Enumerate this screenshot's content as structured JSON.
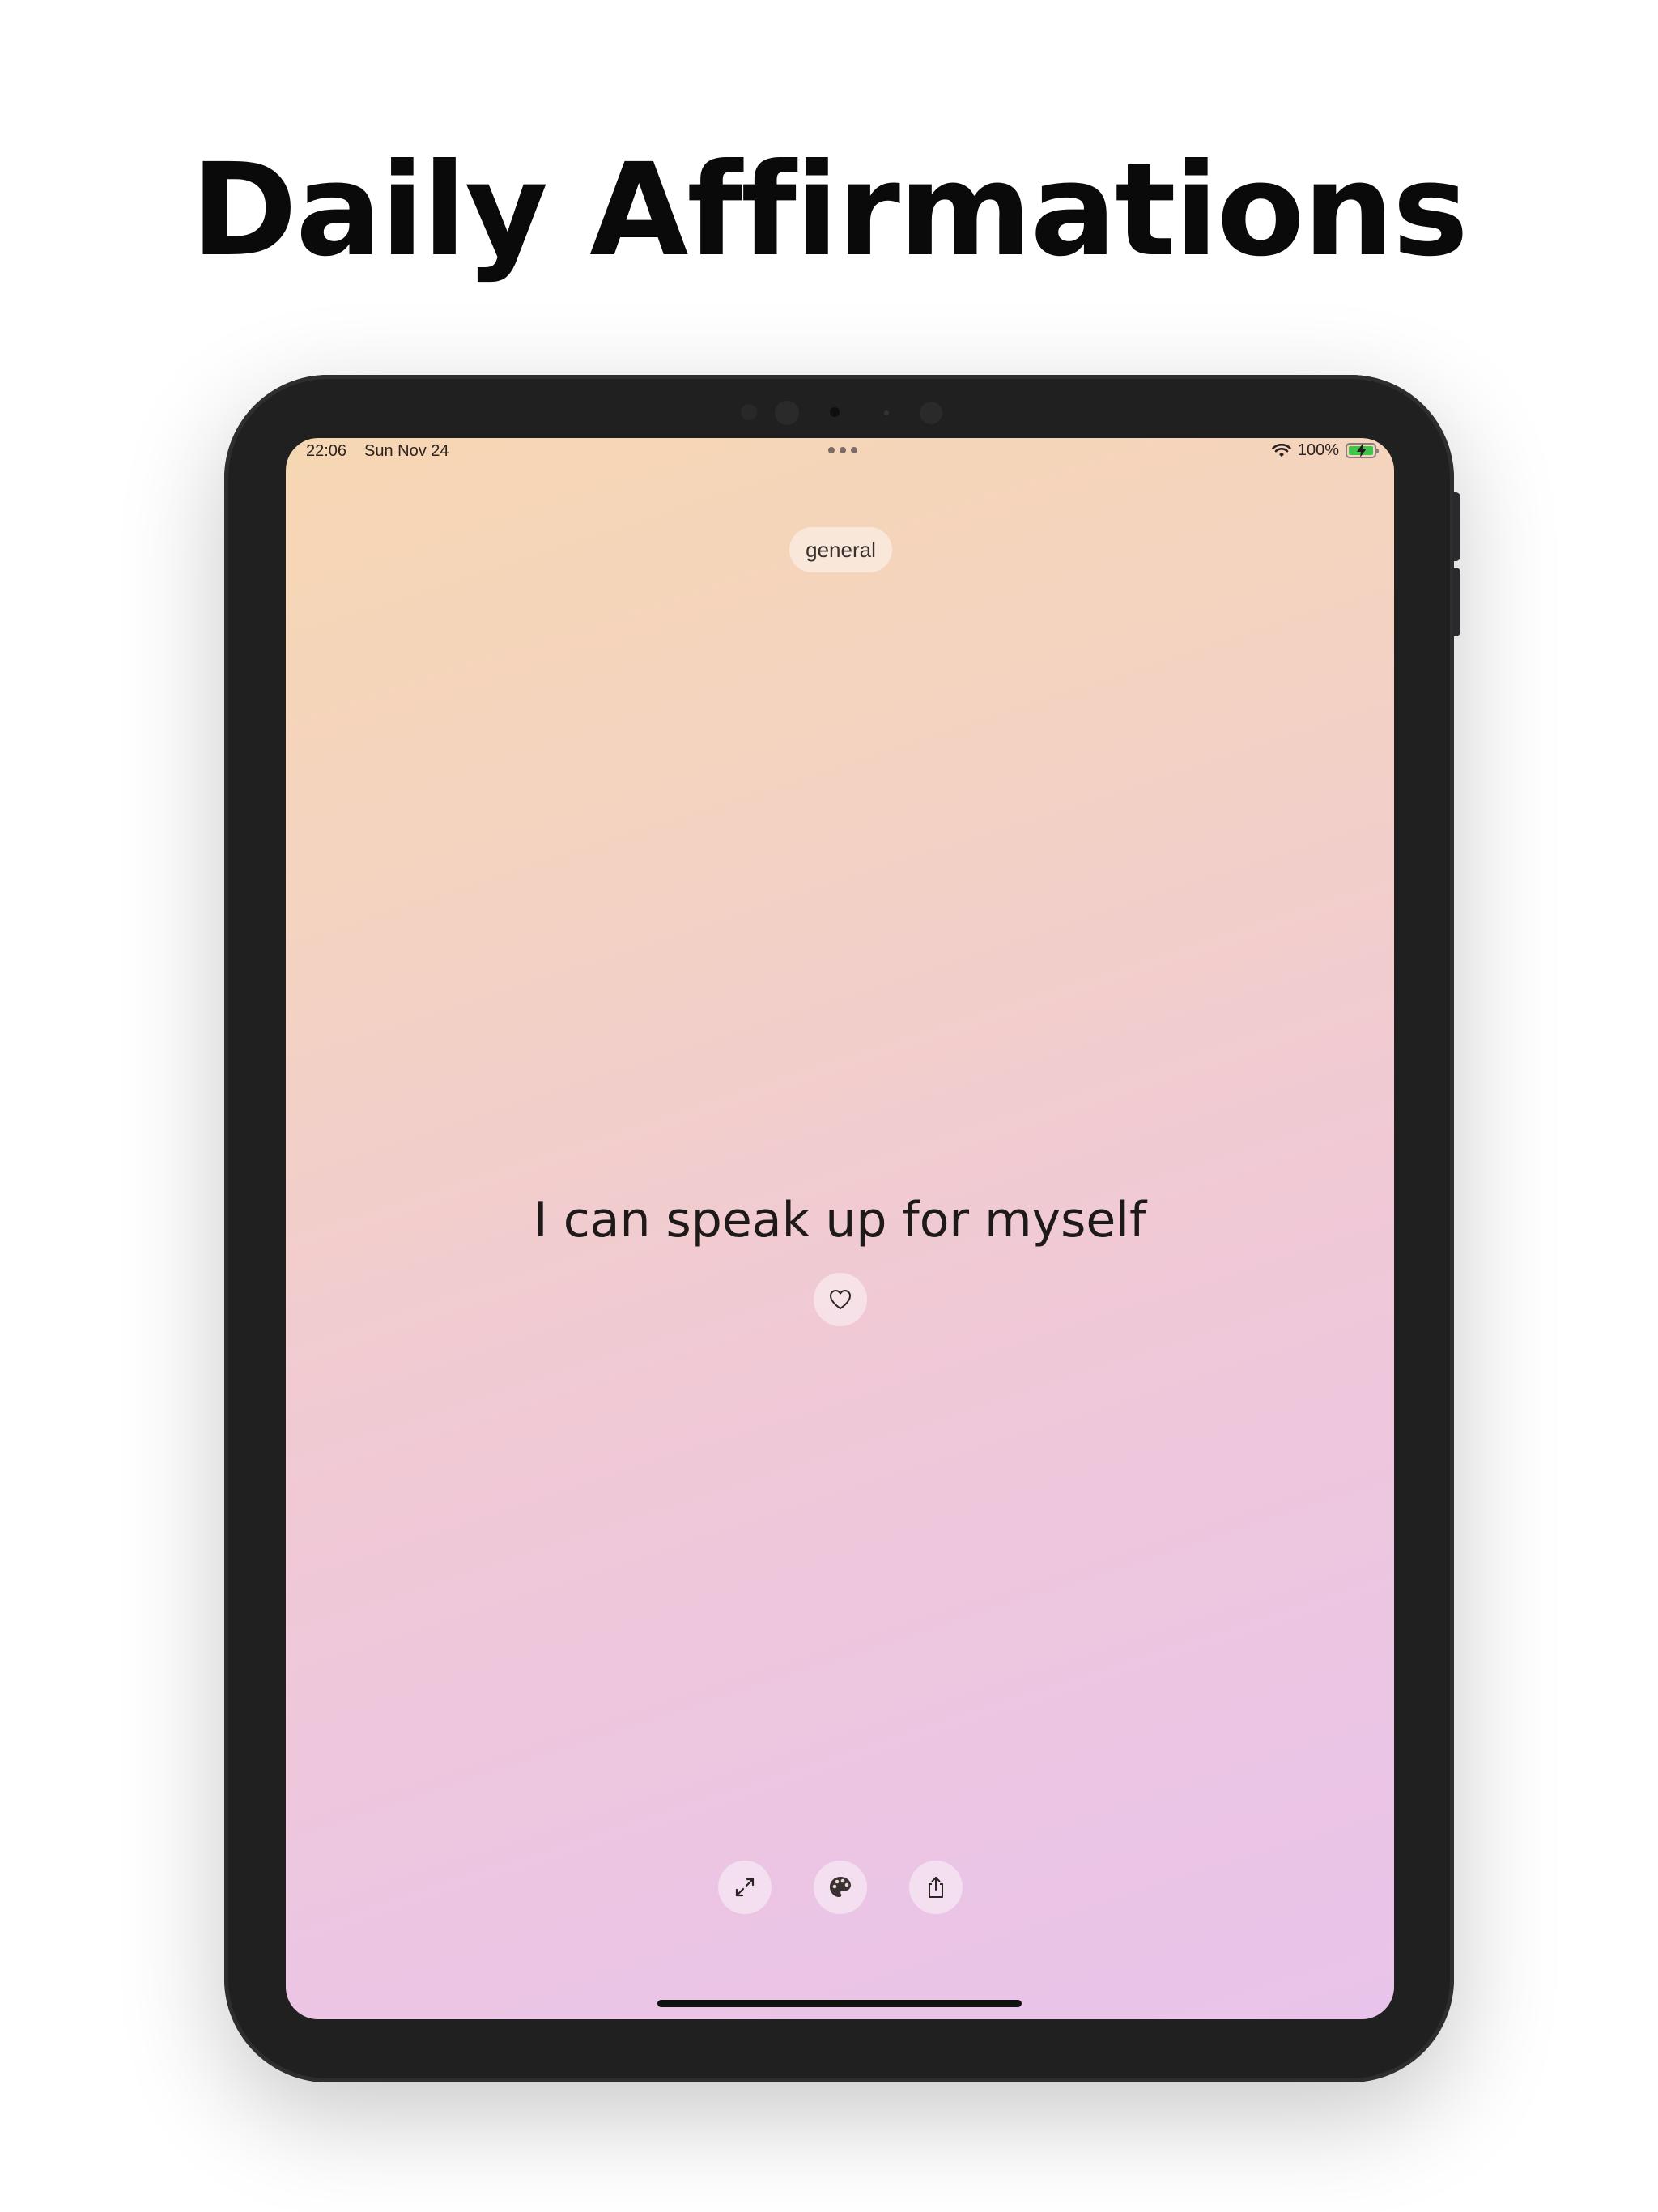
{
  "headline": "Daily Affirmations",
  "status_bar": {
    "time": "22:06",
    "date": "Sun Nov 24",
    "battery_percent": "100%",
    "battery_level": 1.0,
    "charging": true
  },
  "category": {
    "label": "general"
  },
  "affirmation": {
    "text": "I can speak up for myself"
  },
  "actions": {
    "favorite_icon": "heart-icon",
    "bottom": [
      {
        "name": "fullscreen",
        "icon": "expand-icon"
      },
      {
        "name": "theme",
        "icon": "palette-icon"
      },
      {
        "name": "share",
        "icon": "share-icon"
      }
    ]
  },
  "colors": {
    "gradient_top": "#f6d7b3",
    "gradient_bottom": "#e9c4ea",
    "device_frame": "#202020",
    "battery_fill": "#3fc64a"
  }
}
